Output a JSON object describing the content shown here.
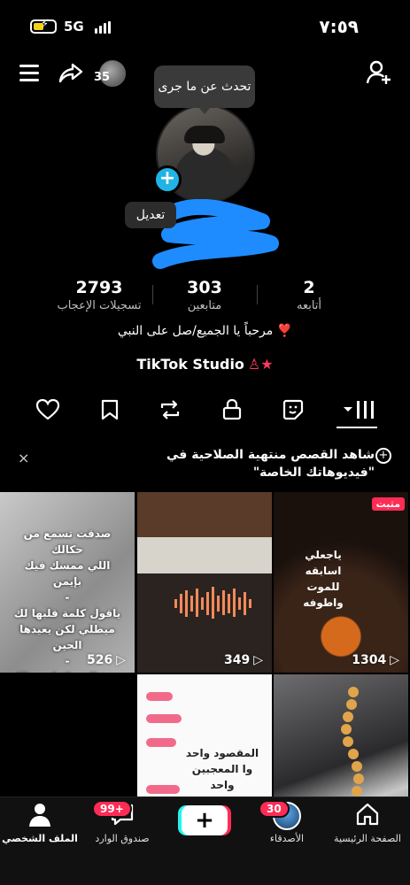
{
  "status_bar": {
    "time": "٧:٥٩",
    "network": "5G"
  },
  "top_nav": {
    "following_count": "35"
  },
  "profile": {
    "note_prompt": "تحدث عن ما جرى",
    "edit_label": "تعديل",
    "bio": "مرحباً يا الجميع/صل على النبي ❣️",
    "studio_label": "TikTok Studio"
  },
  "stats": [
    {
      "value": "2793",
      "label": "تسجيلات الإعجاب"
    },
    {
      "value": "303",
      "label": "متابعين"
    },
    {
      "value": "2",
      "label": "أتابعه"
    }
  ],
  "tabs": [
    "grid-icon",
    "smile-sticker-icon",
    "lock-icon",
    "repost-icon",
    "bookmark-icon",
    "heart-icon"
  ],
  "banner": {
    "text_line1": "شاهد القصص منتهية الصلاحية في",
    "text_line2": "\"فيديوهاتك الخاصة\"",
    "close_label": "×"
  },
  "videos": [
    {
      "views": "526",
      "overlay": "صدقت تسمع من حكالك\nاللي ممسك فيك بإيمن\n-\nياقول كلمة قلبها لك\nميطلي لكن يعيدها الحين\n-\nيسم الذي كمل جمالك\nماتساك ماومنا على الدين\n-"
    },
    {
      "views": "349",
      "overlay": ""
    },
    {
      "views": "1304",
      "overlay": "ياجعلي\nاسابقه\nللموت\nواطوفه",
      "pinned": "مثبت"
    },
    {
      "views": "",
      "overlay": ""
    },
    {
      "views": "",
      "overlay": "المقصود واحد\nوا المعجبين واحد"
    },
    {
      "views": "",
      "overlay": ""
    }
  ],
  "bottom_nav": {
    "profile": "الملف الشخصي",
    "inbox": "صندوق الوارد",
    "inbox_badge": "99+",
    "create": "+",
    "friends": "الأصدقاء",
    "friends_badge": "30",
    "home": "الصفحة الرئيسية"
  },
  "colors": {
    "accent": "#fe2c55",
    "cyan": "#25f4ee",
    "avatar_plus": "#20b3e6"
  }
}
